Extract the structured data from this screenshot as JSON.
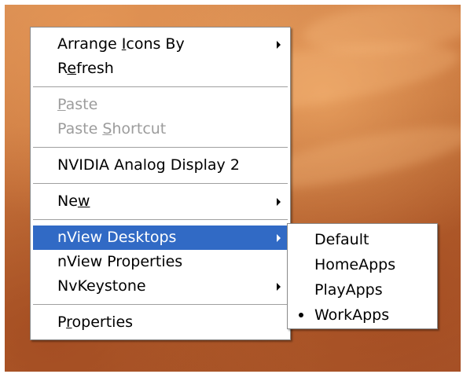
{
  "context_menu": {
    "items": [
      {
        "pre": "Arrange ",
        "key": "I",
        "post": "cons By",
        "enabled": true,
        "submenu": true
      },
      {
        "pre": "R",
        "key": "e",
        "post": "fresh",
        "enabled": true,
        "submenu": false
      },
      {
        "pre": "",
        "key": "P",
        "post": "aste",
        "enabled": false,
        "submenu": false
      },
      {
        "pre": "Paste ",
        "key": "S",
        "post": "hortcut",
        "enabled": false,
        "submenu": false
      },
      {
        "pre": "NVIDIA Analog Display 2",
        "key": "",
        "post": "",
        "enabled": true,
        "submenu": false
      },
      {
        "pre": "Ne",
        "key": "w",
        "post": "",
        "enabled": true,
        "submenu": true
      },
      {
        "pre": "nView Desktops",
        "key": "",
        "post": "",
        "enabled": true,
        "submenu": true,
        "highlighted": true
      },
      {
        "pre": "nView Properties",
        "key": "",
        "post": "",
        "enabled": true,
        "submenu": false
      },
      {
        "pre": "NvKeystone",
        "key": "",
        "post": "",
        "enabled": true,
        "submenu": true
      },
      {
        "pre": "P",
        "key": "r",
        "post": "operties",
        "enabled": true,
        "submenu": false
      }
    ]
  },
  "submenu": {
    "items": [
      {
        "label": "Default",
        "checked": false
      },
      {
        "label": "HomeApps",
        "checked": false
      },
      {
        "label": "PlayApps",
        "checked": false
      },
      {
        "label": "WorkApps",
        "checked": true
      }
    ]
  },
  "colors": {
    "highlight": "#316ac5",
    "disabled_text": "#9c9c9c"
  }
}
